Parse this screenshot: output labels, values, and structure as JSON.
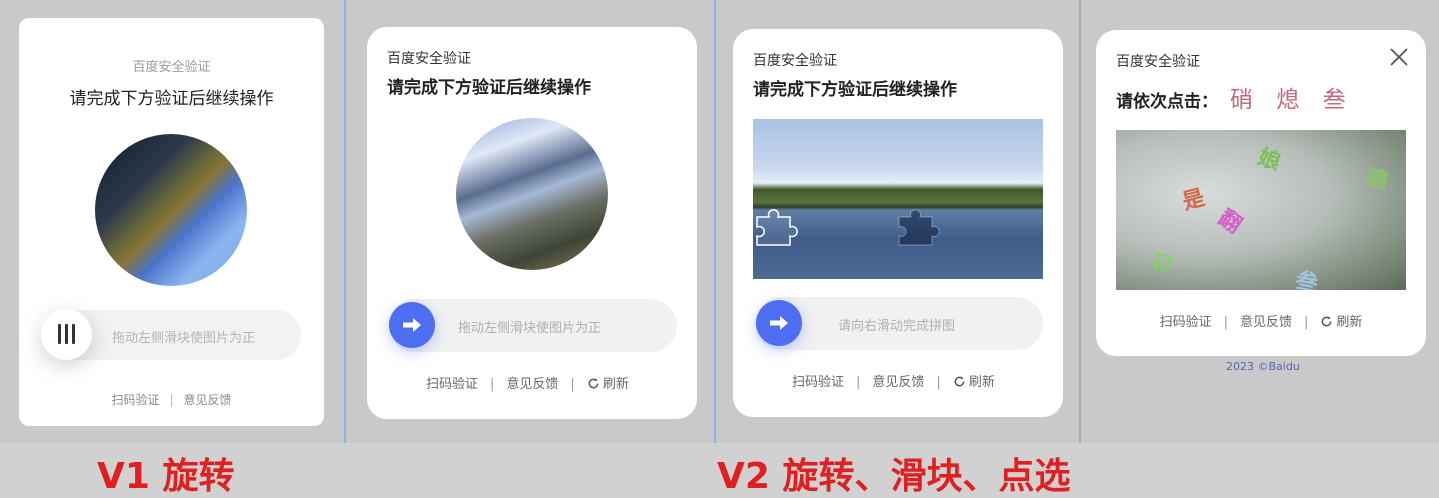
{
  "v1": {
    "title": "百度安全验证",
    "subtitle": "请完成下方验证后继续操作",
    "slider_hint": "拖动左侧滑块使图片为正",
    "footer": {
      "scan": "扫码验证",
      "sep": "|",
      "feedback": "意见反馈"
    },
    "label": "V1 旋转"
  },
  "v2_rotate": {
    "title": "百度安全验证",
    "subtitle": "请完成下方验证后继续操作",
    "slider_hint": "拖动左侧滑块使图片为正",
    "footer": {
      "scan": "扫码验证",
      "sep": "|",
      "feedback": "意见反馈",
      "refresh": "刷新"
    }
  },
  "v2_puzzle": {
    "title": "百度安全验证",
    "subtitle": "请完成下方验证后继续操作",
    "slider_hint": "请向右滑动完成拼图",
    "footer": {
      "scan": "扫码验证",
      "sep": "|",
      "feedback": "意见反馈",
      "refresh": "刷新"
    }
  },
  "v2_click": {
    "title": "百度安全验证",
    "instruction": "请依次点击：",
    "targets": "硝 熄 叁",
    "image_chars": [
      "娘",
      "是",
      "德",
      "翻",
      "心",
      "叁"
    ],
    "footer": {
      "scan": "扫码验证",
      "sep": "|",
      "feedback": "意见反馈",
      "refresh": "刷新"
    },
    "copyright": "2023 ©Baidu"
  },
  "labels": {
    "v2": "V2 旋转、滑块、点选"
  },
  "colors": {
    "accent": "#4e6ef2",
    "label_red": "#e02020",
    "target_text": "#c26a7a"
  },
  "icons": [
    "slider-bars-icon",
    "arrow-right-icon",
    "refresh-icon",
    "close-icon",
    "puzzle-piece-icon"
  ]
}
